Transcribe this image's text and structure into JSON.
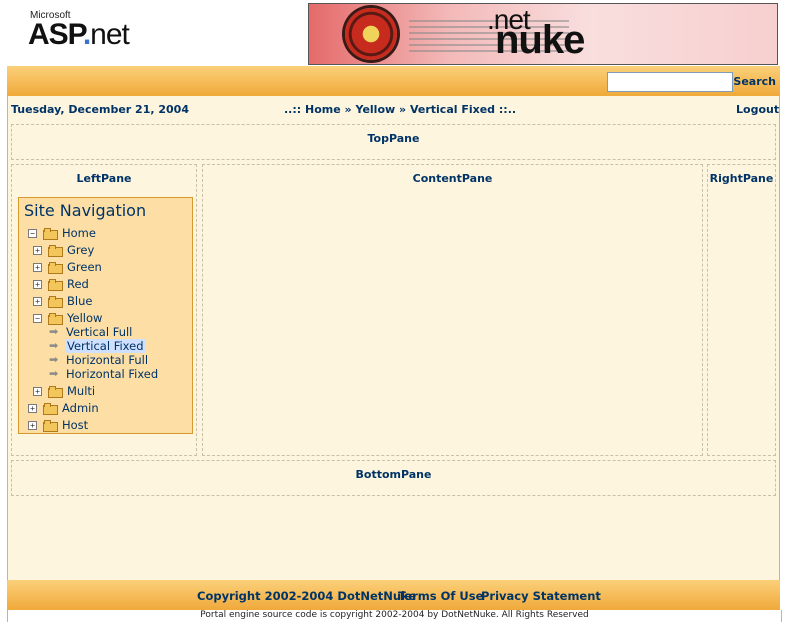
{
  "header": {
    "asp_small": "Microsoft",
    "asp_logo_parts": [
      "ASP",
      ".",
      "net"
    ],
    "dnn_net": ".net",
    "dnn_nuke": "nuke"
  },
  "search": {
    "value": "",
    "link": "Search"
  },
  "date": "Tuesday, December 21, 2004",
  "breadcrumb": {
    "prefix": "..::",
    "items": [
      "Home",
      "Yellow",
      "Vertical Fixed"
    ],
    "separator": "»",
    "suffix": "::.."
  },
  "logout": "Logout",
  "panes": {
    "top": "TopPane",
    "left": "LeftPane",
    "content": "ContentPane",
    "right": "RightPane",
    "bottom": "BottomPane"
  },
  "site_navigation": {
    "title": "Site Navigation",
    "items": [
      {
        "label": "Home",
        "expander": "−",
        "icon": "folder-icon"
      },
      {
        "label": "Grey",
        "expander": "+",
        "icon": "folder-icon"
      },
      {
        "label": "Green",
        "expander": "+",
        "icon": "folder-icon"
      },
      {
        "label": "Red",
        "expander": "+",
        "icon": "folder-icon"
      },
      {
        "label": "Blue",
        "expander": "+",
        "icon": "folder-icon"
      },
      {
        "label": "Yellow",
        "expander": "−",
        "icon": "folder-icon"
      },
      {
        "label": "Vertical Full",
        "icon": "arrow-icon"
      },
      {
        "label": "Vertical Fixed",
        "icon": "arrow-icon",
        "selected": true
      },
      {
        "label": "Horizontal Full",
        "icon": "arrow-icon"
      },
      {
        "label": "Horizontal Fixed",
        "icon": "arrow-icon"
      },
      {
        "label": "Multi",
        "expander": "+",
        "icon": "folder-icon"
      },
      {
        "label": "Admin",
        "expander": "+",
        "icon": "folder-icon"
      },
      {
        "label": "Host",
        "expander": "+",
        "icon": "folder-icon"
      }
    ]
  },
  "footer": {
    "copyright": "Copyright 2002-2004 DotNetNuke",
    "terms": "Terms Of Use",
    "privacy": "Privacy Statement",
    "source_note": "Portal engine source code is copyright 2002-2004 by DotNetNuke. All Rights Reserved"
  },
  "colors": {
    "bar_orange": "#f0a93a",
    "cream": "#fef5df",
    "nav_box": "#fddfa6",
    "text_navy": "#003366"
  }
}
